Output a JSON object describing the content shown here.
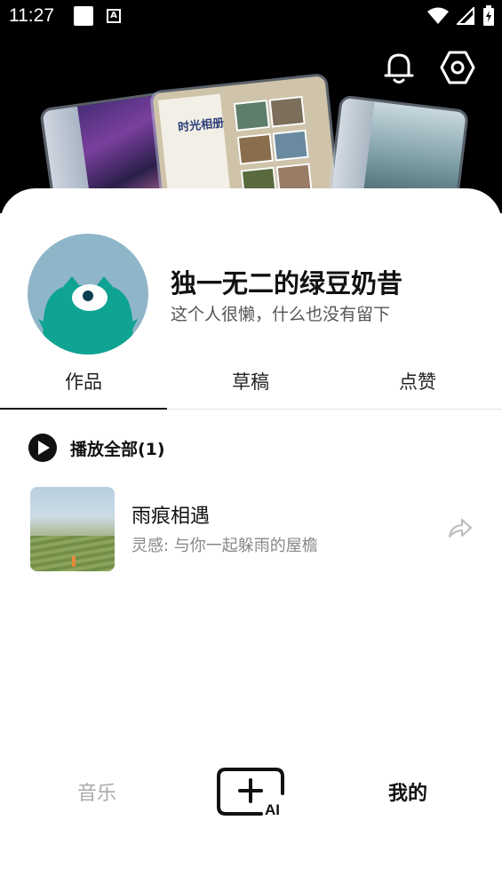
{
  "status_bar": {
    "time": "11:27",
    "icons": [
      "notification-square-icon",
      "a-badge-icon",
      "wifi-icon",
      "signal-icon",
      "battery-icon"
    ]
  },
  "header": {
    "banner_album_title": "时光相册",
    "icons": [
      "bell-icon",
      "settings-icon"
    ]
  },
  "profile": {
    "username": "独一无二的绿豆奶昔",
    "bio": "这个人很懒，什么也没有留下"
  },
  "tabs": [
    {
      "label": "作品",
      "active": true
    },
    {
      "label": "草稿",
      "active": false
    },
    {
      "label": "点赞",
      "active": false
    }
  ],
  "play_all": {
    "label": "播放全部(1)"
  },
  "songs": [
    {
      "title": "雨痕相遇",
      "subtitle": "灵感: 与你一起躲雨的屋檐"
    }
  ],
  "bottom_nav": {
    "music": "音乐",
    "create_ai": "AI",
    "mine": "我的"
  },
  "colors": {
    "header_bg": "#000000",
    "avatar_bg": "#8fb5c9",
    "mascot": "#0fa392",
    "inactive_nav": "#aaaaaa"
  }
}
